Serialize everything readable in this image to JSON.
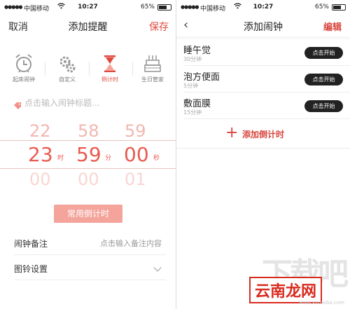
{
  "status_bar": {
    "carrier": "中国移动",
    "time": "10:27",
    "battery": "65%"
  },
  "left_screen": {
    "nav": {
      "left": "取消",
      "title": "添加提醒",
      "right": "保存"
    },
    "types": [
      {
        "label": "起床闹钟",
        "icon": "alarm-clock-icon"
      },
      {
        "label": "自定义",
        "icon": "custom-gears-icon"
      },
      {
        "label": "倒计时",
        "icon": "hourglass-icon",
        "active": true
      },
      {
        "label": "生日管家",
        "icon": "birthday-cake-icon"
      }
    ],
    "title_placeholder": "点击输入闹钟标题...",
    "picker": {
      "hours": [
        "22",
        "23",
        "00"
      ],
      "minutes": [
        "58",
        "59",
        "00"
      ],
      "seconds": [
        "59",
        "00",
        "01"
      ],
      "units": {
        "hour": "时",
        "minute": "分",
        "second": "秒"
      }
    },
    "common_button": "常用倒计时",
    "note": {
      "label": "闹钟备注",
      "placeholder": "点击输入备注内容"
    },
    "ringtone": {
      "label": "图铃设置"
    }
  },
  "right_screen": {
    "nav": {
      "title": "添加闹钟",
      "right": "编辑"
    },
    "items": [
      {
        "name": "睡午觉",
        "duration": "30分钟",
        "button": "点击开始"
      },
      {
        "name": "泡方便面",
        "duration": "5分钟",
        "button": "点击开始"
      },
      {
        "name": "敷面膜",
        "duration": "15分钟",
        "button": "点击开始"
      }
    ],
    "add_label": "添加倒计时"
  },
  "watermark": {
    "brand": "云南龙网",
    "logo_text": "下载吧",
    "site": "www.xiazaiba.com"
  },
  "colors": {
    "accent": "#e0483e",
    "accent_light": "#f4a49b"
  }
}
